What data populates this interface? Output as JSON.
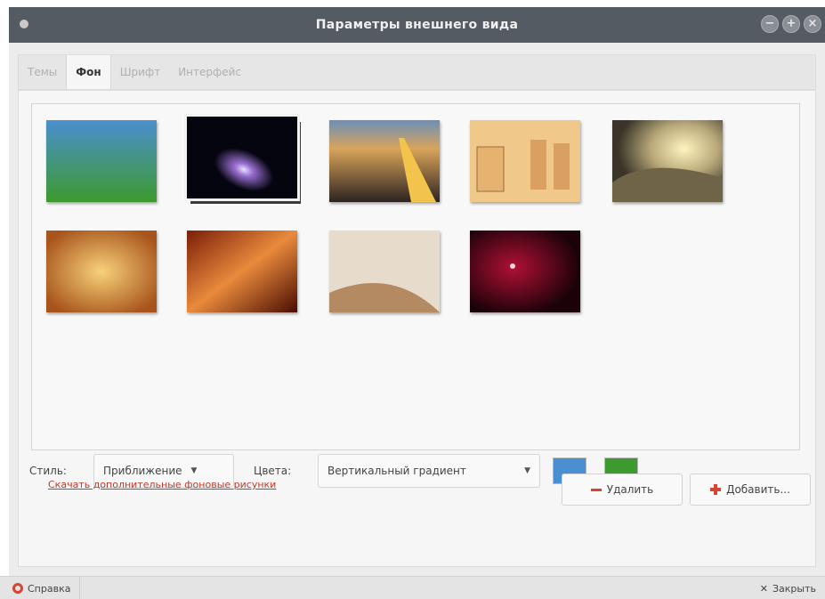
{
  "window": {
    "title": "Параметры внешнего вида"
  },
  "tabs": [
    {
      "label": "Темы",
      "active": false
    },
    {
      "label": "Фон",
      "active": true
    },
    {
      "label": "Шрифт",
      "active": false
    },
    {
      "label": "Интерфейс",
      "active": false
    }
  ],
  "wallpapers": [
    {
      "name": "green-blue-gradient",
      "selected": false
    },
    {
      "name": "comet",
      "selected": true
    },
    {
      "name": "light-trail-road",
      "selected": false
    },
    {
      "name": "sepia-drawing",
      "selected": false
    },
    {
      "name": "golden-waves",
      "selected": false
    },
    {
      "name": "bokeh-orange",
      "selected": false
    },
    {
      "name": "orange-streaks",
      "selected": false
    },
    {
      "name": "beige-curve",
      "selected": false
    },
    {
      "name": "red-sparkles",
      "selected": false
    }
  ],
  "style_row": {
    "style_label": "Стиль:",
    "style_value": "Приближение",
    "colors_label": "Цвета:",
    "colors_value": "Вертикальный градиент",
    "color1": "#4a8fcf",
    "color2": "#3d9a2e"
  },
  "download_link": "Скачать дополнительные фоновые рисунки",
  "buttons": {
    "remove": "Удалить",
    "add": "Добавить..."
  },
  "bottom": {
    "help": "Справка",
    "close": "Закрыть"
  }
}
